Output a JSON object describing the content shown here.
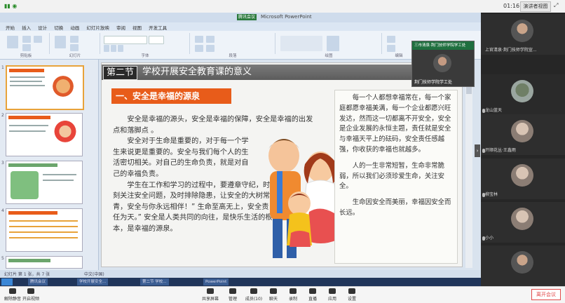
{
  "meeting": {
    "clock": "01:16",
    "view_label": "演讲者视图",
    "leave_label": "离开会议",
    "toolbar": [
      {
        "label": "解除静音",
        "icon": "mic-icon"
      },
      {
        "label": "开启视频",
        "icon": "camera-icon"
      },
      {
        "label": "共享屏幕",
        "icon": "share-screen-icon"
      },
      {
        "label": "管理",
        "icon": "manage-icon"
      },
      {
        "label": "成员(10)",
        "icon": "members-icon"
      },
      {
        "label": "聊天",
        "icon": "chat-icon"
      },
      {
        "label": "录制",
        "icon": "record-icon"
      },
      {
        "label": "直播",
        "icon": "live-icon"
      },
      {
        "label": "应用",
        "icon": "apps-icon"
      },
      {
        "label": "设置",
        "icon": "settings-icon"
      }
    ]
  },
  "ppt": {
    "window_title": "Microsoft PowerPoint",
    "live_badge": "腾讯会议",
    "tabs": [
      "开始",
      "插入",
      "设计",
      "切换",
      "动画",
      "幻灯片放映",
      "审阅",
      "视图",
      "开发工具"
    ],
    "ribbon_groups": [
      "剪贴板",
      "幻灯片",
      "字体",
      "段落",
      "绘图",
      "编辑"
    ],
    "status_left": "幻灯片 第 1 张，共 7 张",
    "status_mid": "中文(中国)",
    "taskbar_items": [
      "腾讯会议",
      "学校开展安全...",
      "第二节 学校...",
      "PowerPoint"
    ]
  },
  "slide": {
    "section": "第二节",
    "heading": "学校开展安全教育课的意义",
    "subtitle": "一、安全是幸福的源泉",
    "left_paragraphs": [
      "安全是幸福的源头，安全是幸福的保障，安全是幸福的出发点和落脚点 。",
      "安全对于生命是重要的，对于每一个学生来说更是重要的。安全与我们每个人的生活密切相关。对自己的生命负责，就是对自己的幸福负责。",
      "学生在工作和学习的过程中，要遵章守纪，时刻关注安全问题，及时排除隐患，让安全的大树常青，安全与你永远相伴！” 生命至高无上，安全责任为天。” 安全是人类共同的向往，是快乐生活的根本，是幸福的源泉。"
    ],
    "right_paragraphs": [
      "每一个人都想幸福常在，每一个家庭都愿幸福美满，每一个企业都愿兴旺发达，然而这一切都离不开安全，安全是企业发展的永恒主题，责任就是安全与幸福天平上的砝码，安全责任感越强，你收获的幸福也就越多。",
      "人的一生非常短暂，生命非常脆弱，所以我们必须珍爱生命，关注安全。",
      "生命因安全而美丽，幸福因安全而长远。"
    ]
  },
  "floating_video": {
    "title": "三市清泉·荆门技师学院学工处",
    "name": "荆门技师学院学工处"
  },
  "participants": [
    {
      "name": "上官清泉·荆门技师学院宣..."
    },
    {
      "name": "龙山蓝天"
    },
    {
      "name": "开顺花丛·王鑫雨"
    },
    {
      "name": "柳宝林"
    },
    {
      "name": "小小"
    },
    {
      "name": ""
    }
  ]
}
